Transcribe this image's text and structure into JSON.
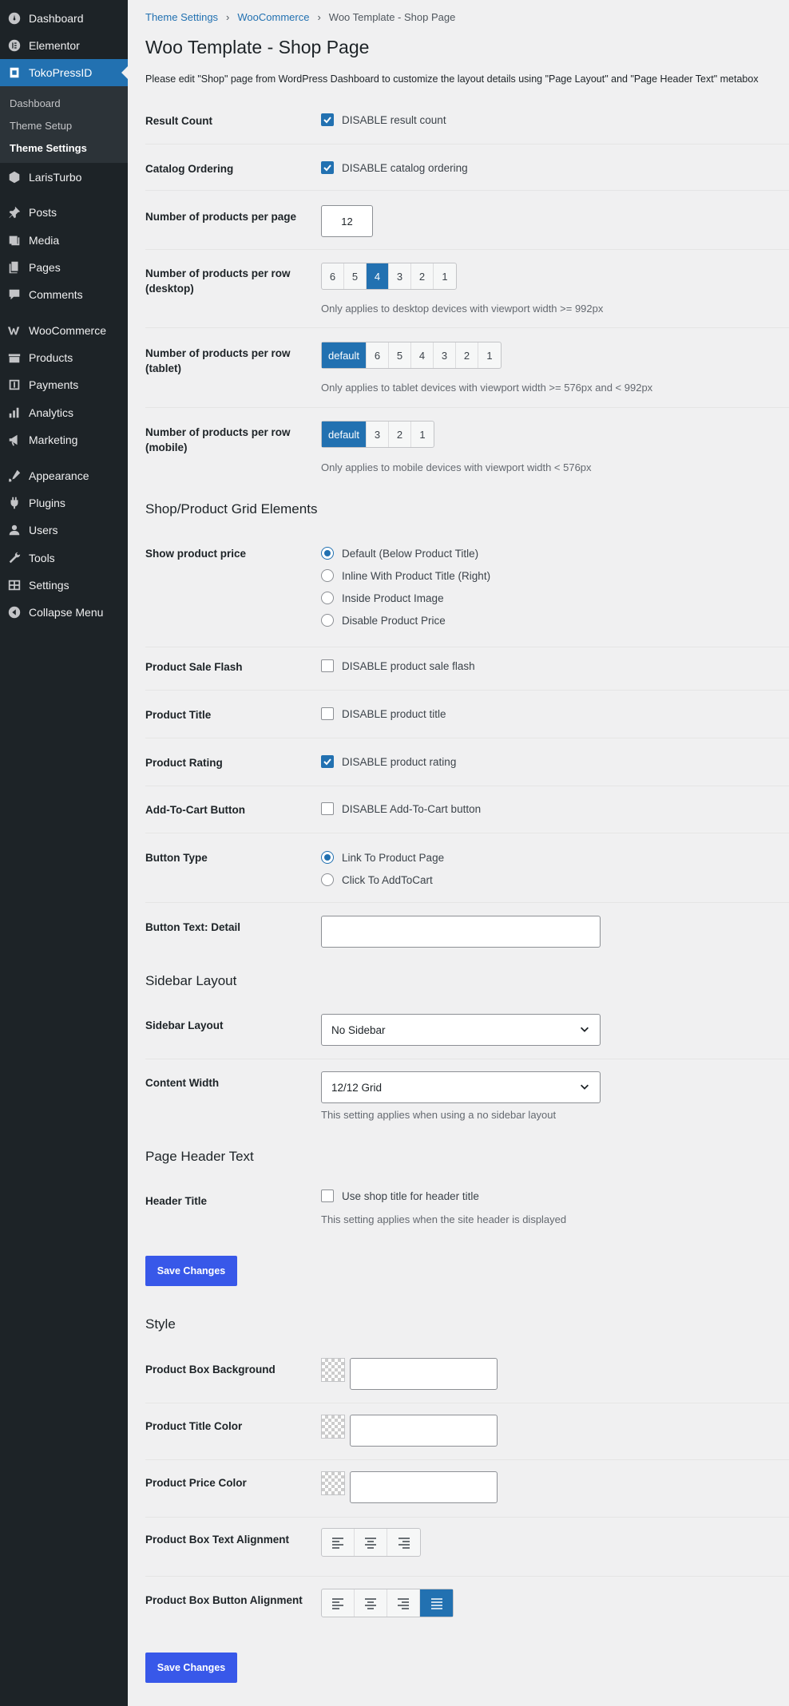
{
  "sidebar": {
    "items_top": [
      {
        "label": "Dashboard",
        "icon": "dashboard-icon"
      },
      {
        "label": "Elementor",
        "icon": "elementor-icon"
      },
      {
        "label": "TokoPressID",
        "icon": "tokopress-icon"
      }
    ],
    "submenu": [
      "Dashboard",
      "Theme Setup",
      "Theme Settings"
    ],
    "items": [
      {
        "label": "LarisTurbo",
        "icon": "laristurbo-icon"
      },
      {
        "label": "Posts",
        "icon": "pin-icon"
      },
      {
        "label": "Media",
        "icon": "media-icon"
      },
      {
        "label": "Pages",
        "icon": "pages-icon"
      },
      {
        "label": "Comments",
        "icon": "comments-icon"
      },
      {
        "label": "WooCommerce",
        "icon": "woocommerce-icon"
      },
      {
        "label": "Products",
        "icon": "products-icon"
      },
      {
        "label": "Payments",
        "icon": "payments-icon"
      },
      {
        "label": "Analytics",
        "icon": "analytics-icon"
      },
      {
        "label": "Marketing",
        "icon": "marketing-icon"
      },
      {
        "label": "Appearance",
        "icon": "appearance-icon"
      },
      {
        "label": "Plugins",
        "icon": "plugins-icon"
      },
      {
        "label": "Users",
        "icon": "users-icon"
      },
      {
        "label": "Tools",
        "icon": "tools-icon"
      },
      {
        "label": "Settings",
        "icon": "settings-icon"
      },
      {
        "label": "Collapse Menu",
        "icon": "collapse-icon"
      }
    ]
  },
  "breadcrumb": {
    "item1": "Theme Settings",
    "item2": "WooCommerce",
    "current": "Woo Template - Shop Page"
  },
  "page_title": "Woo Template - Shop Page",
  "notice": "Please edit \"Shop\" page from WordPress Dashboard to customize the layout details using \"Page Layout\" and \"Page Header Text\" metabox",
  "result_count": {
    "label": "Result Count",
    "text": "DISABLE result count",
    "checked": true
  },
  "catalog_ordering": {
    "label": "Catalog Ordering",
    "text": "DISABLE catalog ordering",
    "checked": true
  },
  "per_page": {
    "label": "Number of products per page",
    "value": "12"
  },
  "row_desktop": {
    "label": "Number of products per row (desktop)",
    "options": [
      "6",
      "5",
      "4",
      "3",
      "2",
      "1"
    ],
    "selected": "4",
    "desc": "Only applies to desktop devices with viewport width >= 992px"
  },
  "row_tablet": {
    "label": "Number of products per row (tablet)",
    "options": [
      "default",
      "6",
      "5",
      "4",
      "3",
      "2",
      "1"
    ],
    "selected": "default",
    "desc": "Only applies to tablet devices with viewport width >= 576px and < 992px"
  },
  "row_mobile": {
    "label": "Number of products per row (mobile)",
    "options": [
      "default",
      "3",
      "2",
      "1"
    ],
    "selected": "default",
    "desc": "Only applies to mobile devices with viewport width < 576px"
  },
  "grid_heading": "Shop/Product Grid Elements",
  "show_price": {
    "label": "Show product price",
    "options": [
      "Default (Below Product Title)",
      "Inline With Product Title (Right)",
      "Inside Product Image",
      "Disable Product Price"
    ],
    "selected": 0
  },
  "sale_flash": {
    "label": "Product Sale Flash",
    "text": "DISABLE product sale flash",
    "checked": false
  },
  "product_title": {
    "label": "Product Title",
    "text": "DISABLE product title",
    "checked": false
  },
  "product_rating": {
    "label": "Product Rating",
    "text": "DISABLE product rating",
    "checked": true
  },
  "add_to_cart": {
    "label": "Add-To-Cart Button",
    "text": "DISABLE Add-To-Cart button",
    "checked": false
  },
  "button_type": {
    "label": "Button Type",
    "options": [
      "Link To Product Page",
      "Click To AddToCart"
    ],
    "selected": 0
  },
  "button_text": {
    "label": "Button Text: Detail",
    "value": ""
  },
  "sidebar_heading": "Sidebar Layout",
  "sidebar_layout": {
    "label": "Sidebar Layout",
    "value": "No Sidebar"
  },
  "content_width": {
    "label": "Content Width",
    "value": "12/12 Grid",
    "desc": "This setting applies when using a no sidebar layout"
  },
  "header_heading": "Page Header Text",
  "header_title": {
    "label": "Header Title",
    "text": "Use shop title for header title",
    "checked": false,
    "desc": "This setting applies when the site header is displayed"
  },
  "save_label": "Save Changes",
  "style_heading": "Style",
  "box_bg": {
    "label": "Product Box Background",
    "value": ""
  },
  "title_color": {
    "label": "Product Title Color",
    "value": ""
  },
  "price_color": {
    "label": "Product Price Color",
    "value": ""
  },
  "text_align": {
    "label": "Product Box Text Alignment",
    "selected": "none"
  },
  "button_align": {
    "label": "Product Box Button Alignment",
    "selected": "justify"
  },
  "colors": {
    "accent": "#2271b1",
    "save_button": "#3858e9",
    "sidebar_bg": "#1d2327"
  }
}
